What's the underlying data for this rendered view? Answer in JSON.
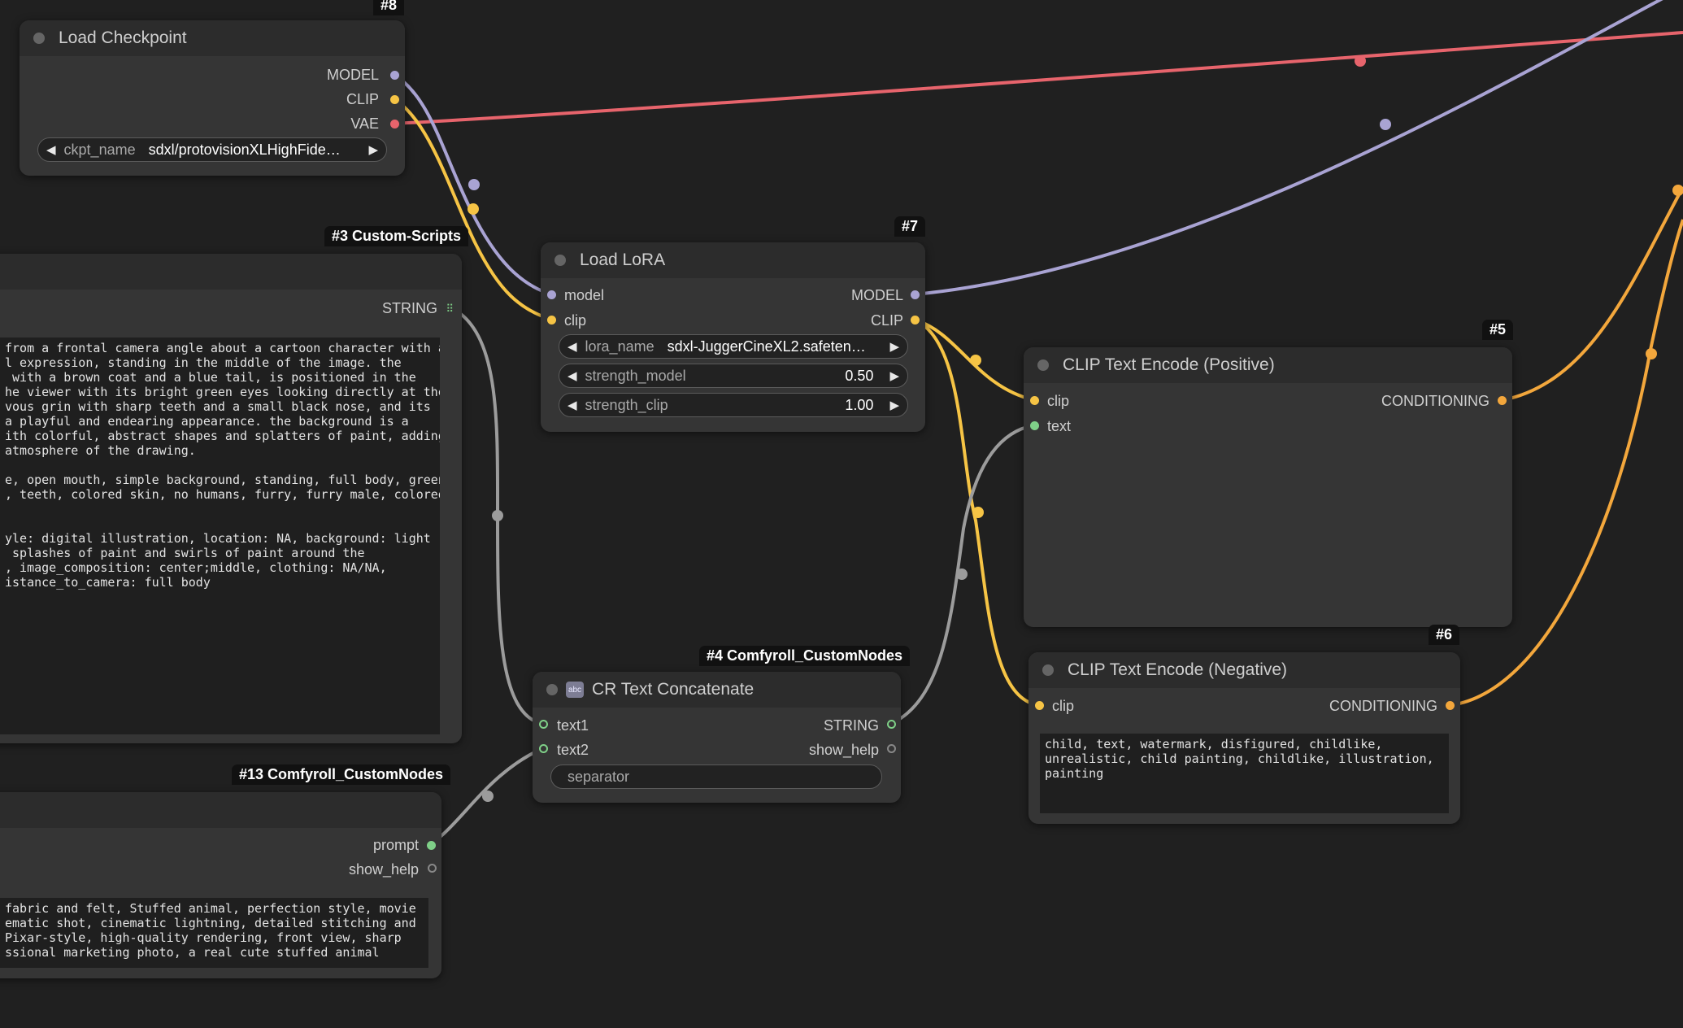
{
  "colors": {
    "model": "#a9a3d3",
    "clip": "#f6c445",
    "vae": "#e7646c",
    "string": "#9c9c9c",
    "conditioning": "#f3a73c",
    "text": "#7fd088"
  },
  "nodes": {
    "load_checkpoint": {
      "tag": "#8",
      "title": "Load Checkpoint",
      "outputs": [
        "MODEL",
        "CLIP",
        "VAE"
      ],
      "widget": {
        "label": "ckpt_name",
        "value": "sdxl/protovisionXLHighFide…"
      }
    },
    "custom_scripts": {
      "tag": "#3 Custom-Scripts",
      "output": "STRING",
      "text": "from a frontal camera angle about a cartoon character with a\nl expression, standing in the middle of the image. the\n with a brown coat and a blue tail, is positioned in the\nhe viewer with its bright green eyes looking directly at the\nvous grin with sharp teeth and a small black nose, and its\na playful and endearing appearance. the background is a\nith colorful, abstract shapes and splatters of paint, adding\natmosphere of the drawing.\n\ne, open mouth, simple background, standing, full body, green\n, teeth, colored skin, no humans, furry, furry male, colored\n\n\nyle: digital illustration, location: NA, background: light\n splashes of paint and swirls of paint around the\n, image_composition: center;middle, clothing: NA/NA,\nistance_to_camera: full body"
    },
    "load_lora": {
      "tag": "#7",
      "title": "Load LoRA",
      "inputs": [
        "model",
        "clip"
      ],
      "outputs": [
        "MODEL",
        "CLIP"
      ],
      "widgets": [
        {
          "label": "lora_name",
          "value": "sdxl-JuggerCineXL2.safeten…"
        },
        {
          "label": "strength_model",
          "value": "0.50"
        },
        {
          "label": "strength_clip",
          "value": "1.00"
        }
      ]
    },
    "clip_positive": {
      "tag": "#5",
      "title": "CLIP Text Encode (Positive)",
      "inputs": [
        "clip",
        "text"
      ],
      "output": "CONDITIONING"
    },
    "clip_negative": {
      "tag": "#6",
      "title": "CLIP Text Encode (Negative)",
      "input": "clip",
      "output": "CONDITIONING",
      "text": "child, text, watermark, disfigured, childlike,\nunrealistic, child painting, childlike, illustration,\npainting"
    },
    "cr_text_concat": {
      "tag": "#4 Comfyroll_CustomNodes",
      "title": "CR Text Concatenate",
      "icon": "abc",
      "inputs": [
        "text1",
        "text2"
      ],
      "outputs": [
        "STRING",
        "show_help"
      ],
      "widget": {
        "value": "separator"
      }
    },
    "comfyroll_13": {
      "tag": "#13 Comfyroll_CustomNodes",
      "outputs": [
        "prompt",
        "show_help"
      ],
      "text": "fabric and felt, Stuffed animal, perfection style, movie\nematic shot, cinematic lightning, detailed stitching and\nPixar-style, high-quality rendering, front view, sharp\nssional marketing photo, a real cute stuffed animal"
    }
  }
}
